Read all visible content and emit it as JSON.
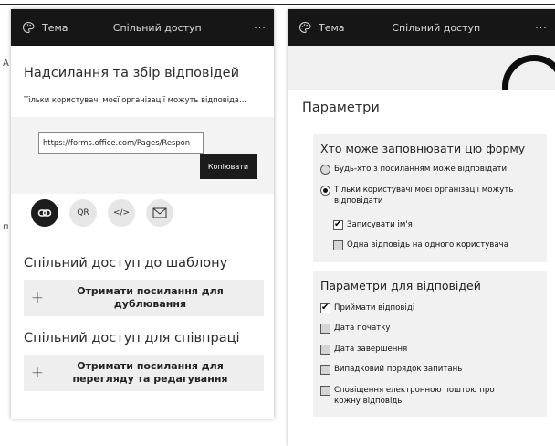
{
  "stray_glyphs": {
    "a": "А",
    "p": "п"
  },
  "left": {
    "topbar": {
      "theme_icon": "palette-icon",
      "theme_label": "Тема",
      "share_label": "Спільний доступ",
      "more_label": "···"
    },
    "send_section": {
      "title": "Надсилання та збір відповідей",
      "subtitle": "Тільки користувачі моєї організації можуть відповіда...",
      "link_value": "https://forms.office.com/Pages/Respon",
      "copy_label": "Копіювати",
      "icons": [
        {
          "name": "link-icon",
          "label": "",
          "active": true
        },
        {
          "name": "qr-icon",
          "label": "QR",
          "active": false
        },
        {
          "name": "embed-icon",
          "label": "</>",
          "active": false
        },
        {
          "name": "email-icon",
          "label": "",
          "active": false
        }
      ]
    },
    "template_section": {
      "title": "Спільний доступ до шаблону",
      "button_plus": "+",
      "button_label": "Отримати посилання для дублювання"
    },
    "collab_section": {
      "title": "Спільний доступ для співпраці",
      "button_plus": "+",
      "button_label": "Отримати посилання для перегляду та редагування"
    }
  },
  "right": {
    "topbar": {
      "theme_icon": "palette-icon",
      "theme_label": "Тема",
      "share_label": "Спільний доступ",
      "more_label": "···"
    },
    "title": "Параметри",
    "who_card": {
      "title": "Хто може заповнювати цю форму",
      "options": [
        {
          "label": "Будь-хто з посиланням може відповідати",
          "selected": false
        },
        {
          "label": "Тільки користувачі моєї організації можуть відповідати",
          "selected": true
        }
      ],
      "sub_checks": [
        {
          "label": "Записувати ім'я",
          "checked": true
        },
        {
          "label": "Одна відповідь на одного користувача",
          "checked": false
        }
      ]
    },
    "resp_card": {
      "title": "Параметри для відповідей",
      "checks": [
        {
          "label": "Приймати відповіді",
          "checked": true
        },
        {
          "label": "Дата початку",
          "checked": false
        },
        {
          "label": "Дата завершення",
          "checked": false
        },
        {
          "label": "Випадковий порядок запитань",
          "checked": false
        },
        {
          "label": "Сповіщення електронною поштою про кожну відповідь",
          "checked": false
        }
      ]
    }
  }
}
